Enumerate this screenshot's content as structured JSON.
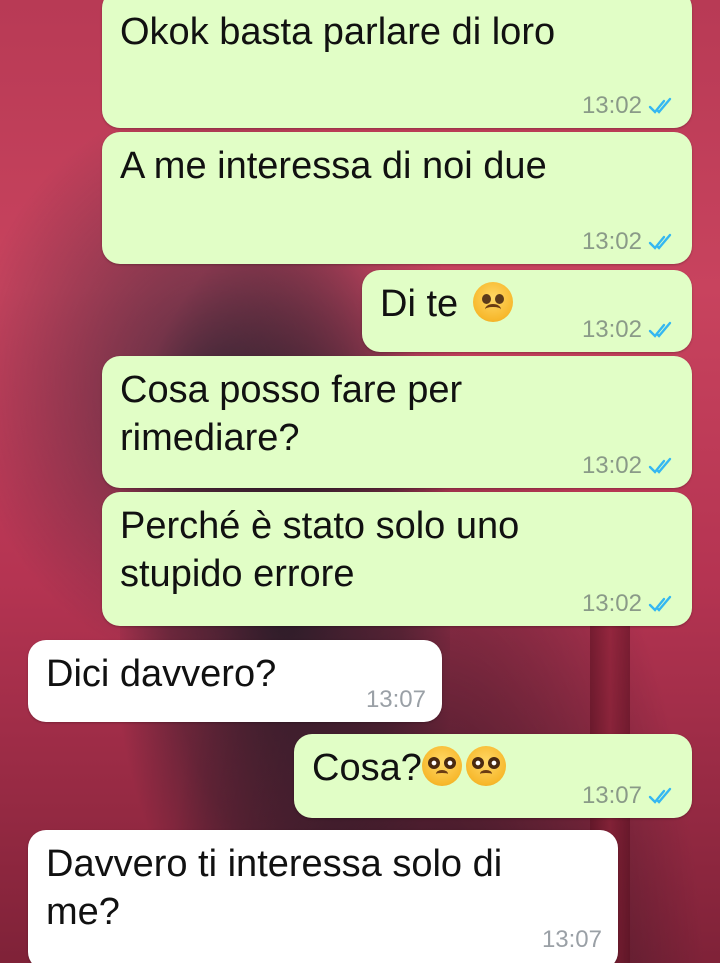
{
  "messages": [
    {
      "text": "Okok basta parlare di loro",
      "time": "13:02",
      "direction": "outgoing",
      "status": "read"
    },
    {
      "text": "A me interessa di noi due",
      "time": "13:02",
      "direction": "outgoing",
      "status": "read"
    },
    {
      "text": "Di te",
      "emoji": "frowning-face-icon",
      "time": "13:02",
      "direction": "outgoing",
      "status": "read"
    },
    {
      "text": "Cosa posso fare per rimediare?",
      "time": "13:02",
      "direction": "outgoing",
      "status": "read"
    },
    {
      "text": "Perché è stato solo uno stupido errore",
      "time": "13:02",
      "direction": "outgoing",
      "status": "read"
    },
    {
      "text": "Dici davvero?",
      "time": "13:07",
      "direction": "incoming"
    },
    {
      "text": "Cosa?",
      "emoji": "pleading-face-icon",
      "emoji_count": 2,
      "time": "13:07",
      "direction": "outgoing",
      "status": "read"
    },
    {
      "text": "Davvero ti interessa solo di me?",
      "time": "13:07",
      "direction": "incoming"
    }
  ],
  "colors": {
    "outgoing_bubble": "#e1fec6",
    "incoming_bubble": "#ffffff",
    "read_ticks": "#34b7f1",
    "timestamp": "#8a9a88"
  }
}
